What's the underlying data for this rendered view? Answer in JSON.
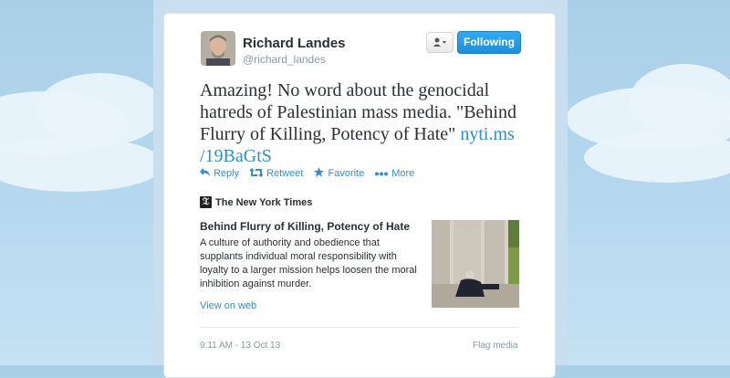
{
  "author": {
    "name": "Richard Landes",
    "handle": "@richard_landes"
  },
  "buttons": {
    "user_actions_icon": "user-dropdown-icon",
    "follow_label": "Following"
  },
  "tweet": {
    "text": "Amazing! No word about the genocidal hatreds of Palestinian mass media. \"Behind Flurry of Killing, Potency of Hate\" ",
    "link": "nyti.ms /19BaGtS"
  },
  "actions": [
    {
      "label": "Reply",
      "icon": "reply-icon"
    },
    {
      "label": "Retweet",
      "icon": "retweet-icon"
    },
    {
      "label": "Favorite",
      "icon": "star-icon"
    },
    {
      "label": "More",
      "icon": "more-icon"
    }
  ],
  "card": {
    "source": "The New York Times",
    "title": "Behind Flurry of Killing, Potency of Hate",
    "description": "A culture of authority and obedience that supplants individual moral responsibility with loyalty to a larger mission helps loosen the moral inhibition against murder.",
    "view_link": "View on web"
  },
  "footer": {
    "timestamp": "9:11 AM - 13 Oct 13",
    "flag": "Flag media"
  },
  "colors": {
    "link": "#2f8fcb",
    "follow_button": "#1d8fd8",
    "background": "#a9cfe8"
  }
}
